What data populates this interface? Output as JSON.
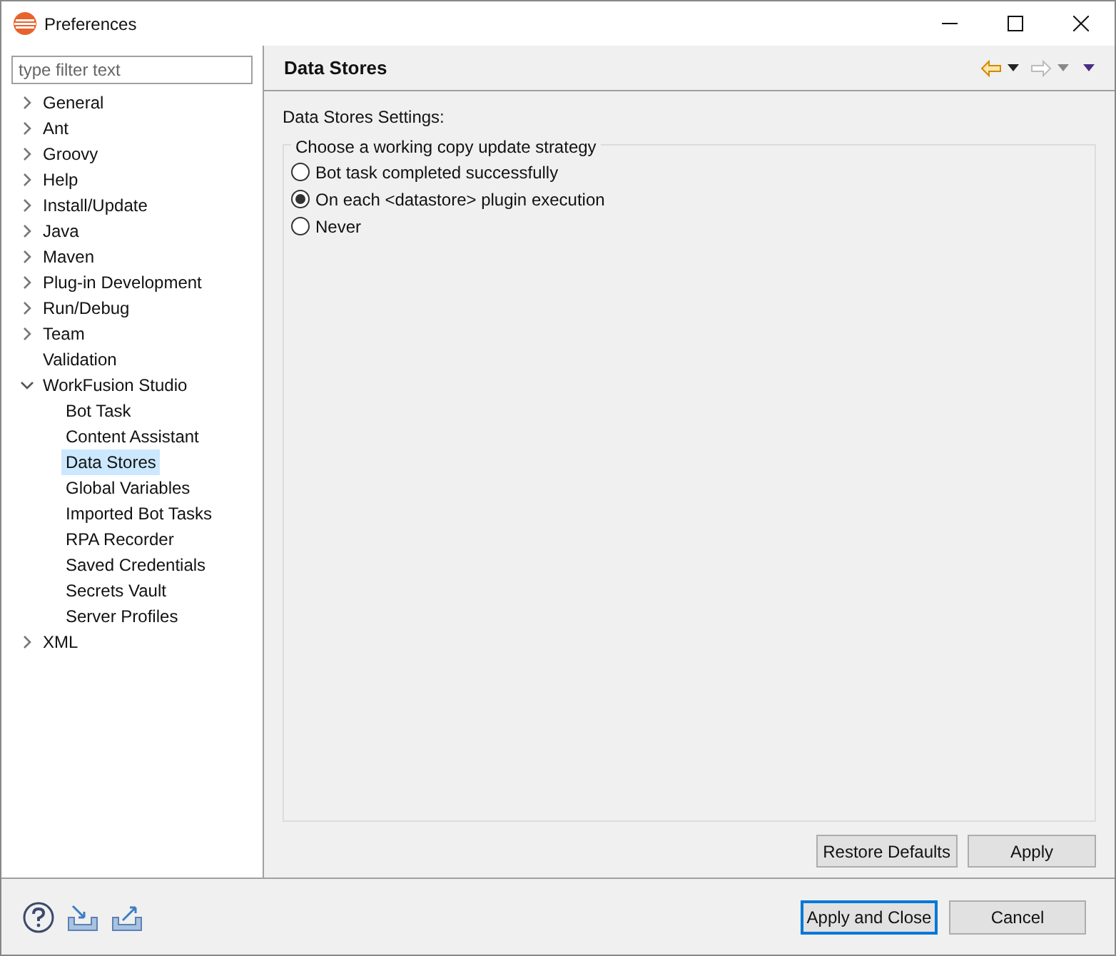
{
  "window": {
    "title": "Preferences"
  },
  "filter": {
    "placeholder": "type filter text"
  },
  "tree": [
    {
      "label": "General",
      "kind": "branch",
      "expanded": false,
      "selected": false
    },
    {
      "label": "Ant",
      "kind": "branch",
      "expanded": false,
      "selected": false
    },
    {
      "label": "Groovy",
      "kind": "branch",
      "expanded": false,
      "selected": false
    },
    {
      "label": "Help",
      "kind": "branch",
      "expanded": false,
      "selected": false
    },
    {
      "label": "Install/Update",
      "kind": "branch",
      "expanded": false,
      "selected": false
    },
    {
      "label": "Java",
      "kind": "branch",
      "expanded": false,
      "selected": false
    },
    {
      "label": "Maven",
      "kind": "branch",
      "expanded": false,
      "selected": false
    },
    {
      "label": "Plug-in Development",
      "kind": "branch",
      "expanded": false,
      "selected": false
    },
    {
      "label": "Run/Debug",
      "kind": "branch",
      "expanded": false,
      "selected": false
    },
    {
      "label": "Team",
      "kind": "branch",
      "expanded": false,
      "selected": false
    },
    {
      "label": "Validation",
      "kind": "leaf",
      "selected": false
    },
    {
      "label": "WorkFusion Studio",
      "kind": "branch",
      "expanded": true,
      "selected": false,
      "children": [
        {
          "label": "Bot Task",
          "selected": false
        },
        {
          "label": "Content Assistant",
          "selected": false
        },
        {
          "label": "Data Stores",
          "selected": true
        },
        {
          "label": "Global Variables",
          "selected": false
        },
        {
          "label": "Imported Bot Tasks",
          "selected": false
        },
        {
          "label": "RPA Recorder",
          "selected": false
        },
        {
          "label": "Saved Credentials",
          "selected": false
        },
        {
          "label": "Secrets Vault",
          "selected": false
        },
        {
          "label": "Server Profiles",
          "selected": false
        }
      ]
    },
    {
      "label": "XML",
      "kind": "branch",
      "expanded": false,
      "selected": false
    }
  ],
  "page": {
    "title": "Data Stores",
    "settings_label": "Data Stores Settings:",
    "group": {
      "title": "Choose a working copy update strategy",
      "options": [
        {
          "label": "Bot task completed successfully",
          "selected": false
        },
        {
          "label": "On each <datastore> plugin execution",
          "selected": true
        },
        {
          "label": "Never",
          "selected": false
        }
      ]
    },
    "buttons": [
      "Restore Defaults",
      "Apply"
    ]
  },
  "footer_buttons": [
    {
      "label": "Apply and Close",
      "default": true
    },
    {
      "label": "Cancel",
      "default": false
    }
  ]
}
